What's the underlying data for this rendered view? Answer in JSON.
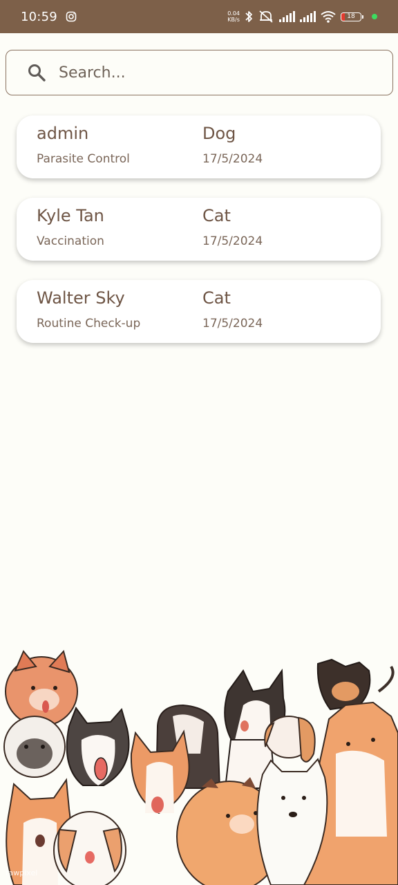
{
  "status_bar": {
    "time": "10:59",
    "network_speed_value": "0.04",
    "network_speed_unit": "KB/s",
    "battery_level": "18",
    "battery_color": "#e33b2e",
    "dot_color": "#3ddc60",
    "icons": [
      "instagram-icon",
      "bluetooth-icon",
      "silent-icon",
      "signal-icon",
      "signal-icon",
      "wifi-icon",
      "battery-icon"
    ]
  },
  "search": {
    "placeholder": "Search..."
  },
  "records": [
    {
      "owner": "admin",
      "service": "Parasite Control",
      "pet": "Dog",
      "date": "17/5/2024"
    },
    {
      "owner": "Kyle Tan",
      "service": "Vaccination",
      "pet": "Cat",
      "date": "17/5/2024"
    },
    {
      "owner": "Walter Sky",
      "service": "Routine Check-up",
      "pet": "Cat",
      "date": "17/5/2024"
    }
  ],
  "watermark": "rawpixel",
  "colors": {
    "status_bar_bg": "#7d6049",
    "page_bg": "#fdfdf8",
    "text_brown": "#6e5545"
  }
}
